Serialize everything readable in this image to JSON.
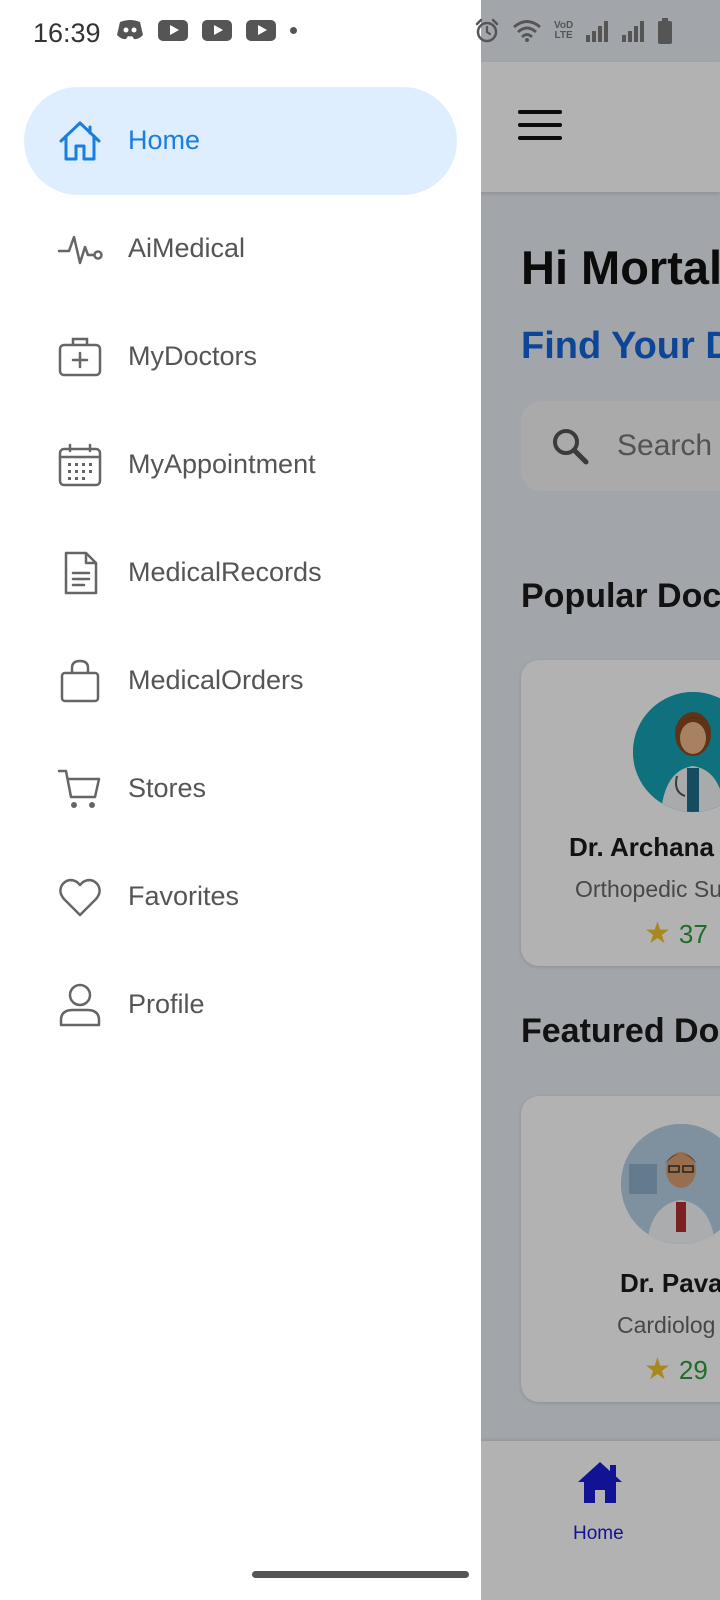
{
  "status_bar": {
    "time": "16:39",
    "left_icons": [
      "discord-icon",
      "youtube-icon",
      "youtube-icon",
      "youtube-icon",
      "notification-dot"
    ],
    "right_icons": [
      "alarm-icon",
      "wifi-icon",
      "volte-icon",
      "signal-icon",
      "signal-icon",
      "battery-icon"
    ],
    "volte_text_top": "VoD",
    "volte_text_bottom": "LTE"
  },
  "drawer": {
    "items": [
      {
        "label": "Home",
        "icon": "home-icon",
        "active": true
      },
      {
        "label": "AiMedical",
        "icon": "heartbeat-icon",
        "active": false
      },
      {
        "label": "MyDoctors",
        "icon": "medical-kit-icon",
        "active": false
      },
      {
        "label": "MyAppointment",
        "icon": "calendar-icon",
        "active": false
      },
      {
        "label": "MedicalRecords",
        "icon": "document-icon",
        "active": false
      },
      {
        "label": "MedicalOrders",
        "icon": "shopping-bag-icon",
        "active": false
      },
      {
        "label": "Stores",
        "icon": "cart-icon",
        "active": false
      },
      {
        "label": "Favorites",
        "icon": "heart-icon",
        "active": false
      },
      {
        "label": "Profile",
        "icon": "user-icon",
        "active": false
      }
    ],
    "active_color": "#1a7de0",
    "active_bg": "#dfeefe"
  },
  "app": {
    "greeting": "Hi Mortal",
    "find_title": "Find Your D",
    "search_placeholder": "Search",
    "popular_title": "Popular Doct",
    "featured_title": "Featured Doc",
    "popular_doctor": {
      "name": "Dr. Archana",
      "specialty": "Orthopedic Su",
      "rating": "37"
    },
    "featured_doctor": {
      "name": "Dr. Pava",
      "specialty": "Cardiolog",
      "rating": "29"
    },
    "bottom_nav": {
      "home_label": "Home"
    },
    "accent_color": "#1565d8"
  }
}
